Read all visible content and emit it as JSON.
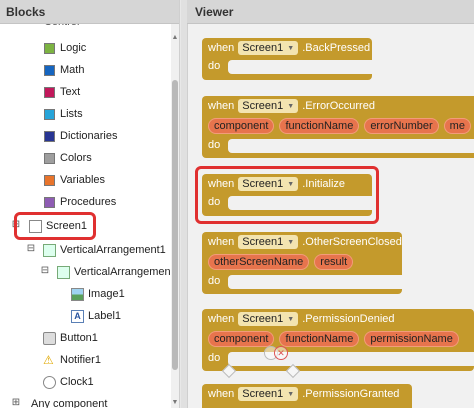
{
  "blocks_panel": {
    "title": "Blocks",
    "partial_top_item": "Control",
    "builtins": [
      {
        "label": "Logic",
        "color": "#7cb342"
      },
      {
        "label": "Math",
        "color": "#1565c0"
      },
      {
        "label": "Text",
        "color": "#c2185b"
      },
      {
        "label": "Lists",
        "color": "#26a4d9"
      },
      {
        "label": "Dictionaries",
        "color": "#283593"
      },
      {
        "label": "Colors",
        "color": "#9e9e9e"
      },
      {
        "label": "Variables",
        "color": "#e8742b"
      },
      {
        "label": "Procedures",
        "color": "#8e5cb3"
      }
    ],
    "components": {
      "screen": "Screen1",
      "vertical1": "VerticalArrangement1",
      "vertical2": "VerticalArrangemen",
      "image": "Image1",
      "label": "Label1",
      "button": "Button1",
      "notifier": "Notifier1",
      "clock": "Clock1",
      "any_component": "Any component"
    }
  },
  "viewer": {
    "title": "Viewer",
    "when": "when",
    "do": "do",
    "screen": "Screen1",
    "events": {
      "back": ".BackPressed",
      "error": ".ErrorOccurred",
      "init": ".Initialize",
      "other": ".OtherScreenClosed",
      "perm_denied": ".PermissionDenied",
      "perm_granted": ".PermissionGranted"
    },
    "params": {
      "error": [
        "component",
        "functionName",
        "errorNumber",
        "me"
      ],
      "other": [
        "otherScreenName",
        "result"
      ],
      "perm_denied": [
        "component",
        "functionName",
        "permissionName"
      ]
    }
  },
  "colors": {
    "event_block": "#c49a2c",
    "param": "#e7744d",
    "highlight": "#e03030"
  }
}
